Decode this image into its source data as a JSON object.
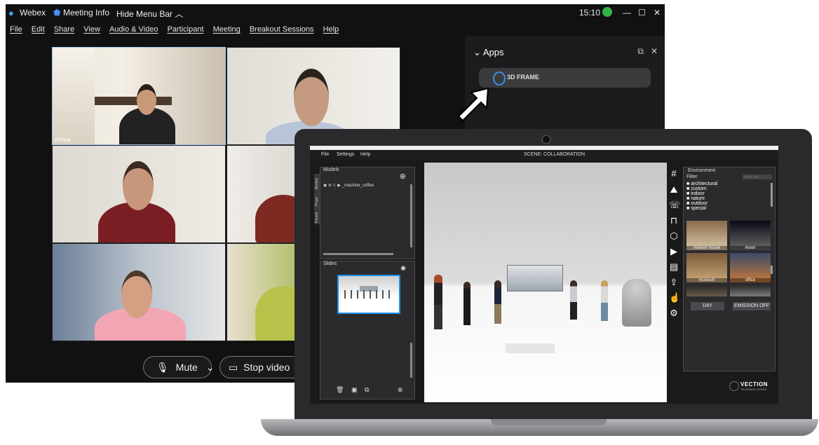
{
  "webex": {
    "app_name": "Webex",
    "meeting_info": "Meeting Info",
    "hide_menu_bar": "Hide Menu Bar",
    "time": "15:10",
    "menu": [
      "File",
      "Edit",
      "Share",
      "View",
      "Audio & Video",
      "Participant",
      "Meeting",
      "Breakout Sessions",
      "Help"
    ],
    "participant_name": "Althea",
    "mute_label": "Mute",
    "stop_video_label": "Stop video",
    "apps_title": "Apps",
    "app_item": "3D FRAME"
  },
  "frame3d": {
    "menu": [
      "File",
      "Settings",
      "Help"
    ],
    "scene_label": "SCENE:",
    "scene_name": "COLLABORATION",
    "models_title": "Models",
    "model_item": "_machine_coffee",
    "side_tabs": [
      "Models",
      "Props",
      "Panels"
    ],
    "slides_title": "Slides",
    "environment_title": "Environment",
    "filter_label": "Filter",
    "filter_placeholder": "Enter text...",
    "categories": [
      "architectural",
      "custom",
      "indoor",
      "nature",
      "outdoor",
      "special"
    ],
    "thumbs": [
      {
        "label": "modern house"
      },
      {
        "label": "moon"
      },
      {
        "label": "museum"
      },
      {
        "label": "office"
      }
    ],
    "day_button": "DAY",
    "emission_button": "EMISSION OFF",
    "brand": "VECTION",
    "brand_sub": "TECHNOLOGIES"
  },
  "colors": {
    "accent": "#1f8fe8",
    "webex_bg": "#111111",
    "viewport_bg": "#d6d6d6"
  }
}
